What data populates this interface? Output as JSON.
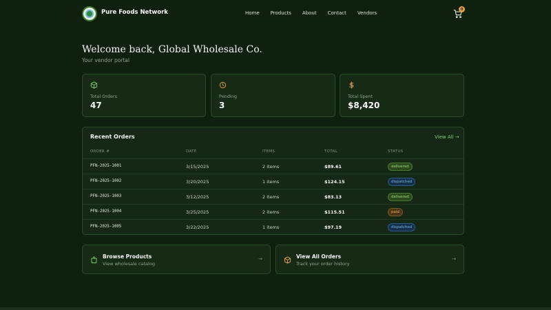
{
  "nav": {
    "brand": "Pure Foods Network",
    "links": [
      "Home",
      "Products",
      "About",
      "Contact",
      "Vendors"
    ],
    "cart_count": "0"
  },
  "welcome": {
    "title": "Welcome back, Global Wholesale Co.",
    "subtitle": "Your vendor portal"
  },
  "stats": [
    {
      "label": "Total Orders",
      "value": "47",
      "icon": "box-icon",
      "color": "#7fcf6a"
    },
    {
      "label": "Pending",
      "value": "3",
      "icon": "clock-icon",
      "color": "#e8a33a"
    },
    {
      "label": "Total Spent",
      "value": "$8,420",
      "icon": "dollar-icon",
      "color": "#e8a33a"
    }
  ],
  "orders": {
    "title": "Recent Orders",
    "view_all": "View All →",
    "columns": [
      "ORDER #",
      "DATE",
      "ITEMS",
      "TOTAL",
      "STATUS"
    ],
    "rows": [
      {
        "id": "PFN-2025-1001",
        "date": "3/15/2025",
        "items": "2 items",
        "total": "$89.61",
        "status": "delivered"
      },
      {
        "id": "PFN-2025-1002",
        "date": "3/20/2025",
        "items": "1 items",
        "total": "$124.15",
        "status": "dispatched"
      },
      {
        "id": "PFN-2025-1003",
        "date": "3/12/2025",
        "items": "2 items",
        "total": "$83.13",
        "status": "delivered"
      },
      {
        "id": "PFN-2025-1004",
        "date": "3/25/2025",
        "items": "2 items",
        "total": "$115.51",
        "status": "paid"
      },
      {
        "id": "PFN-2025-1005",
        "date": "3/22/2025",
        "items": "1 items",
        "total": "$97.19",
        "status": "dispatched"
      }
    ]
  },
  "status_colors": {
    "delivered": {
      "bg": "#2c4a1e",
      "fg": "#9fdc7a",
      "border": "#4a7a2e"
    },
    "dispatched": {
      "bg": "#16304a",
      "fg": "#6fb4e8",
      "border": "#2a5a88"
    },
    "paid": {
      "bg": "#4a3616",
      "fg": "#e8b04a",
      "border": "#7a5a24"
    }
  },
  "actions": [
    {
      "title": "Browse Products",
      "subtitle": "View wholesale catalog",
      "icon": "shopping-bag-icon",
      "color": "#7fcf6a"
    },
    {
      "title": "View All Orders",
      "subtitle": "Track your order history",
      "icon": "package-icon",
      "color": "#e8a33a"
    }
  ]
}
